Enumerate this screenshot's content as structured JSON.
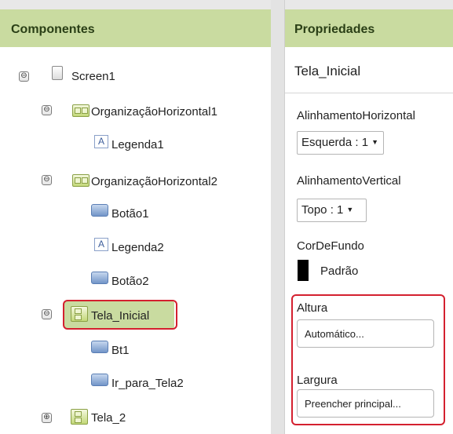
{
  "components": {
    "header": "Componentes",
    "items": [
      {
        "label": "Screen1",
        "icon": "screen-icon",
        "toggle": "⊖"
      },
      {
        "label": "OrganizaçãoHorizontal1",
        "icon": "horizontal-arrangement-icon",
        "toggle": "⊖"
      },
      {
        "label": "Legenda1",
        "icon": "label-icon"
      },
      {
        "label": "OrganizaçãoHorizontal2",
        "icon": "horizontal-arrangement-icon",
        "toggle": "⊖"
      },
      {
        "label": "Botão1",
        "icon": "button-icon"
      },
      {
        "label": "Legenda2",
        "icon": "label-icon"
      },
      {
        "label": "Botão2",
        "icon": "button-icon"
      },
      {
        "label": "Tela_Inicial",
        "icon": "vertical-arrangement-icon",
        "toggle": "⊖",
        "selected": true
      },
      {
        "label": "Bt1",
        "icon": "button-icon"
      },
      {
        "label": "Ir_para_Tela2",
        "icon": "button-icon"
      },
      {
        "label": "Tela_2",
        "icon": "vertical-arrangement-icon",
        "toggle": "⊕"
      }
    ],
    "label_glyph": "A"
  },
  "properties": {
    "header": "Propriedades",
    "component_name": "Tela_Inicial",
    "alinhamento_horizontal": {
      "label": "AlinhamentoHorizontal",
      "value": "Esquerda : 1"
    },
    "alinhamento_vertical": {
      "label": "AlinhamentoVertical",
      "value": "Topo : 1"
    },
    "cor_de_fundo": {
      "label": "CorDeFundo",
      "value": "Padrão",
      "swatch_color": "#000000"
    },
    "altura": {
      "label": "Altura",
      "value": "Automático..."
    },
    "largura": {
      "label": "Largura",
      "value": "Preencher principal..."
    }
  },
  "caret": "▼",
  "colors": {
    "header_bg": "#c9dba0",
    "highlight_border": "#d4202f",
    "selected_bg": "#c9dba0"
  }
}
